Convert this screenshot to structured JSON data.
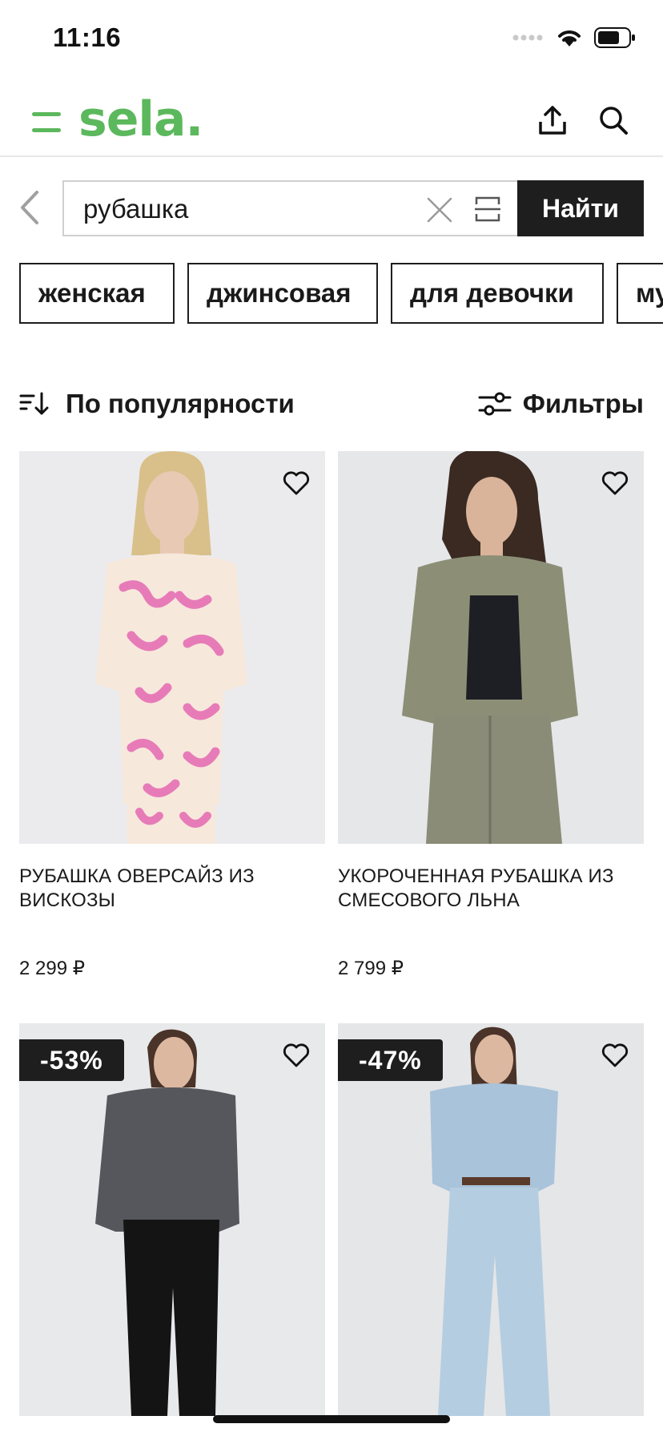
{
  "status_bar": {
    "time": "11:16"
  },
  "header": {
    "brand": "sela."
  },
  "search": {
    "value": "рубашка",
    "submit_label": "Найти"
  },
  "chips": [
    {
      "label": "женская"
    },
    {
      "label": "джинсовая"
    },
    {
      "label": "для девочки"
    },
    {
      "label": "му"
    }
  ],
  "sort": {
    "label": "По популярности"
  },
  "filters": {
    "label": "Фильтры"
  },
  "products": [
    {
      "name": "РУБАШКА ОВЕРСАЙЗ ИЗ ВИСКОЗЫ",
      "price": "2 299 ₽",
      "discount": ""
    },
    {
      "name": "УКОРОЧЕННАЯ РУБАШКА ИЗ СМЕСОВОГО ЛЬНА",
      "price": "2 799 ₽",
      "discount": ""
    },
    {
      "name": "",
      "price": "",
      "discount": "-53%"
    },
    {
      "name": "",
      "price": "",
      "discount": "-47%"
    }
  ],
  "colors": {
    "brand_green": "#5cb85c",
    "dark": "#1e1e1e",
    "image_bg": "#e9eaec"
  },
  "icons": [
    "menu-icon",
    "upload-icon",
    "search-icon",
    "chevron-left-icon",
    "close-icon",
    "scan-icon",
    "sort-icon",
    "sliders-icon",
    "heart-icon"
  ]
}
